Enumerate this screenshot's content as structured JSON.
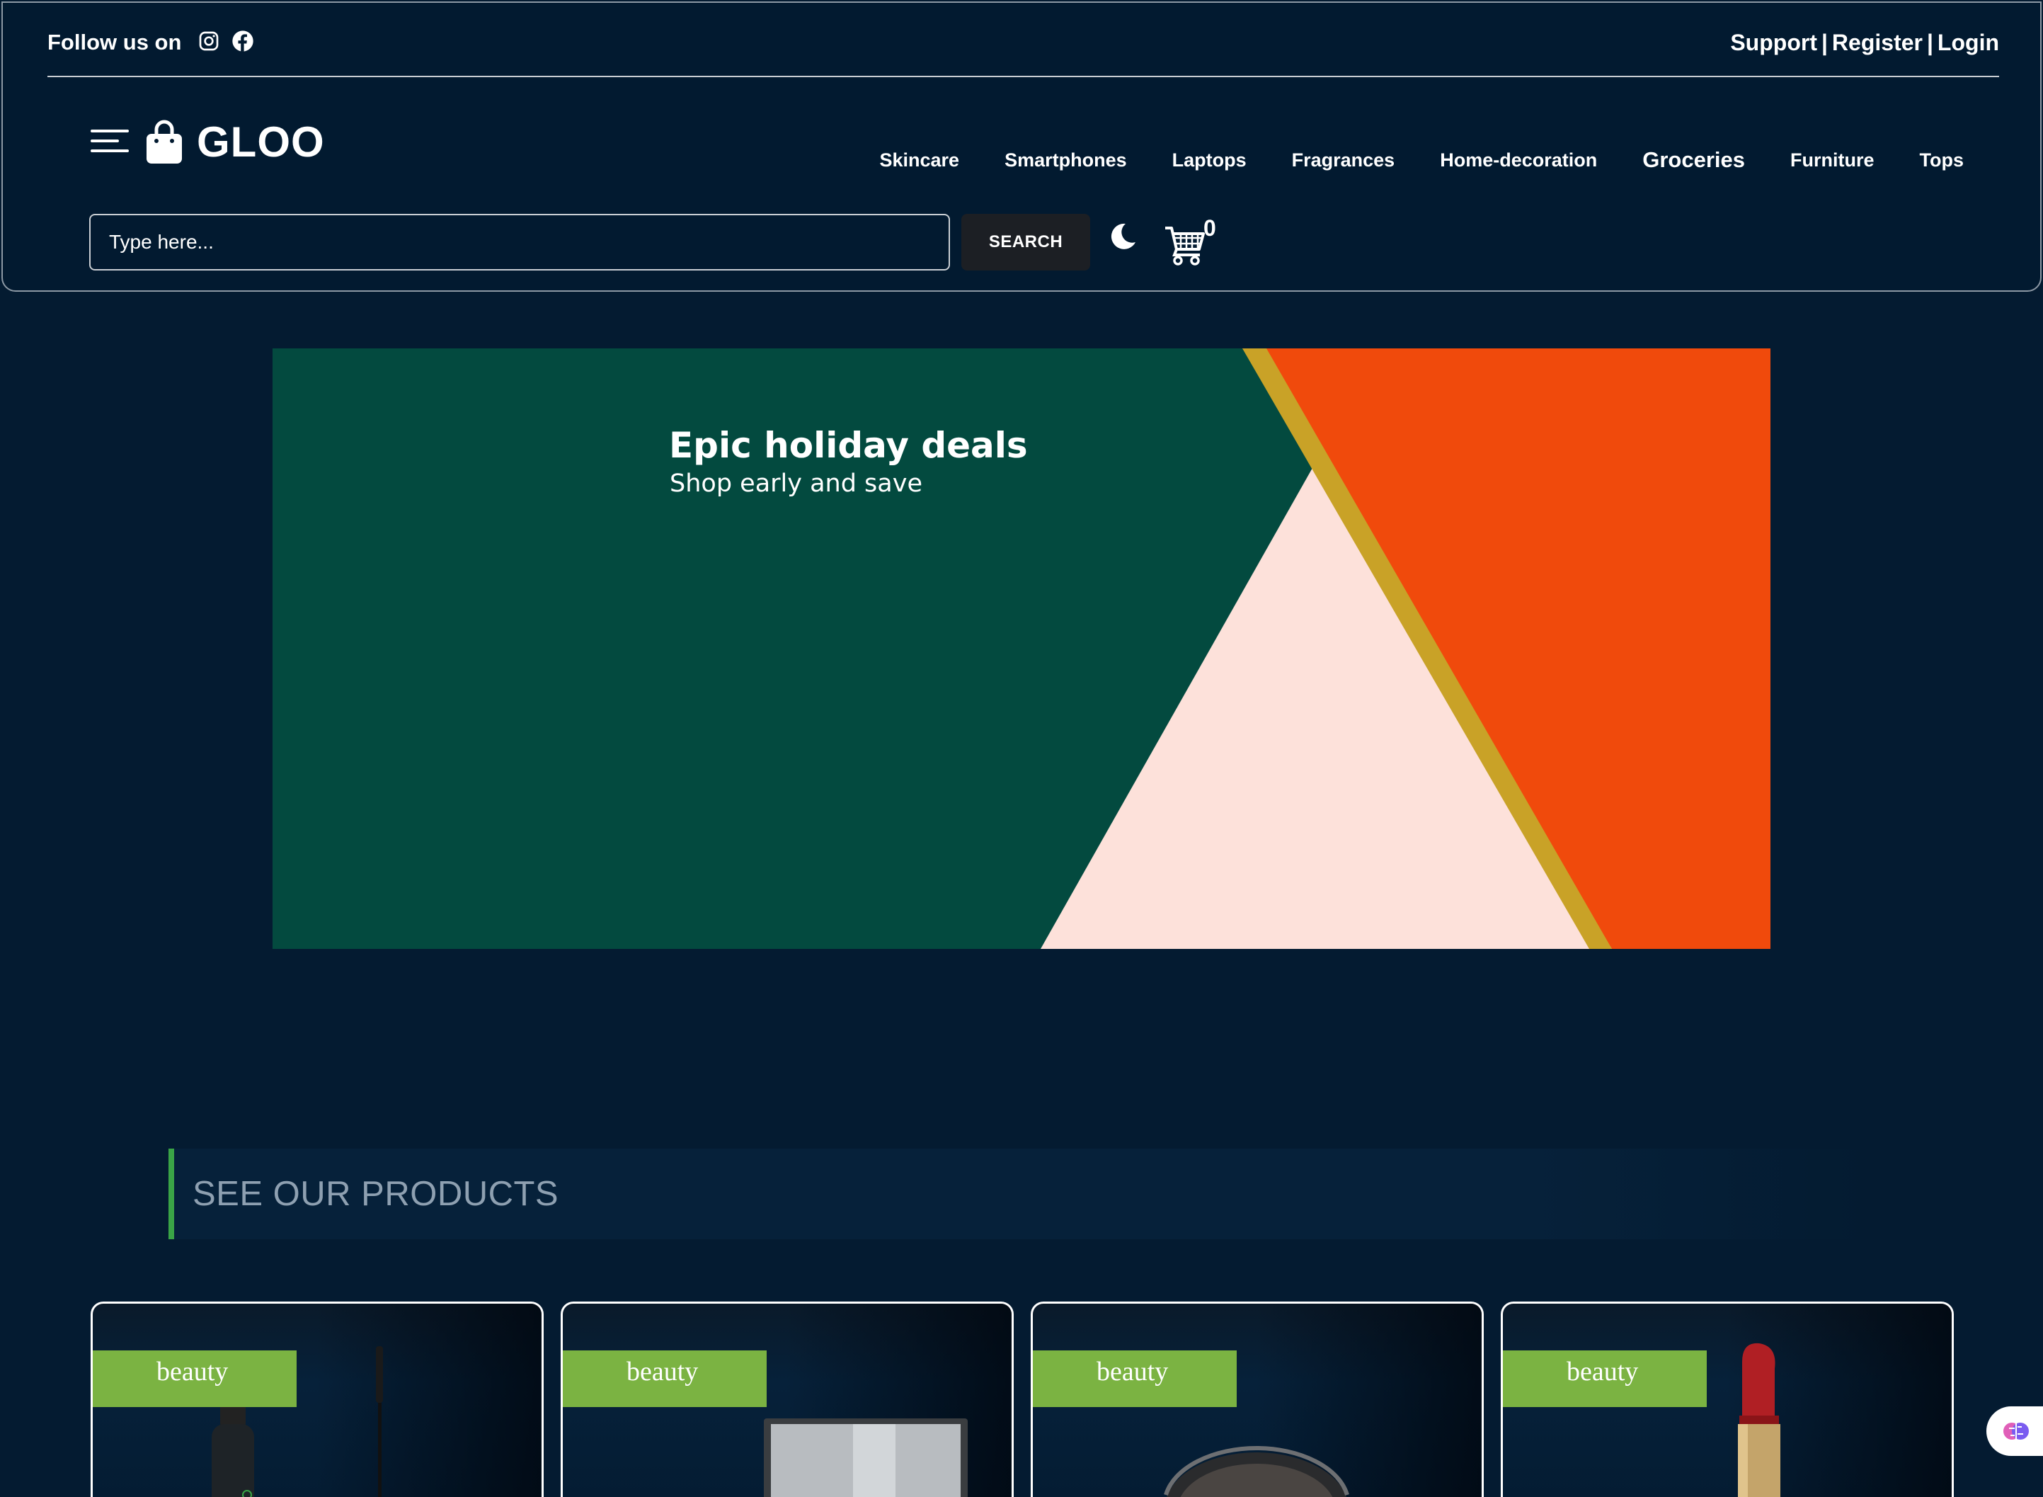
{
  "topbar": {
    "follow_label": "Follow us on",
    "social_icons": [
      "instagram-icon",
      "facebook-icon"
    ],
    "support_label": "Support",
    "register_label": "Register",
    "login_label": "Login",
    "separator": "|"
  },
  "header": {
    "brand": "GLOO",
    "nav": [
      "Skincare",
      "Smartphones",
      "Laptops",
      "Fragrances",
      "Home-decoration",
      "Groceries",
      "Furniture",
      "Tops"
    ],
    "search_placeholder": "Type here...",
    "search_button": "SEARCH",
    "cart_count": "0"
  },
  "hero": {
    "title": "Epic holiday deals",
    "subtitle": "Shop early and save",
    "colors": {
      "green": "#034a3f",
      "pink": "#fde1da",
      "orange": "#f04a0c",
      "gold": "#c9a227"
    }
  },
  "section": {
    "heading": "SEE OUR PRODUCTS",
    "accent": "#3aa446"
  },
  "products": [
    {
      "category": "beauty",
      "art": "mascara"
    },
    {
      "category": "beauty",
      "art": "eyeshadow-palette"
    },
    {
      "category": "beauty",
      "art": "powder-compact"
    },
    {
      "category": "beauty",
      "art": "red-lipstick"
    }
  ],
  "colors": {
    "background": "#041b31",
    "header": "#021a30",
    "badge": "#7bb342",
    "search_button": "#1c1f24"
  }
}
